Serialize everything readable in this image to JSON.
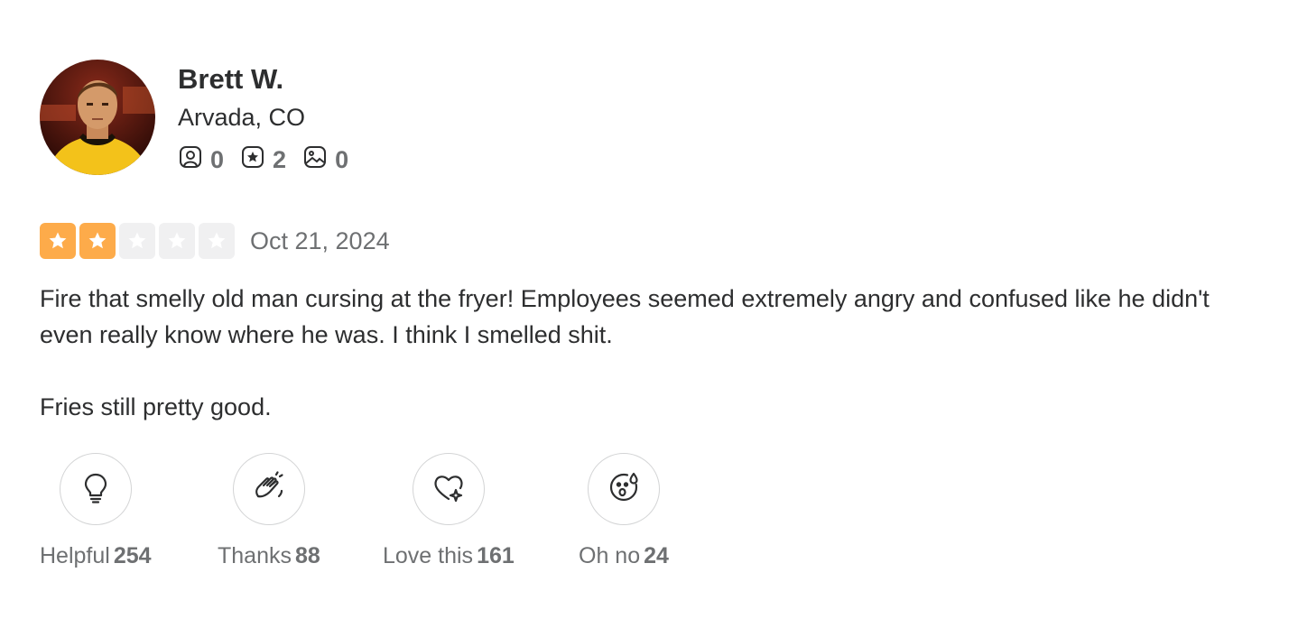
{
  "user": {
    "name": "Brett W.",
    "location": "Arvada, CO",
    "stats": {
      "friends": "0",
      "reviews": "2",
      "photos": "0"
    }
  },
  "review": {
    "rating": 2,
    "max_rating": 5,
    "date": "Oct 21, 2024",
    "paragraphs": [
      "Fire that smelly old man cursing at the fryer! Employees seemed extremely angry and confused like he didn't even really know where he was. I think I smelled shit.",
      "Fries still pretty good."
    ]
  },
  "reactions": [
    {
      "icon": "lightbulb-icon",
      "label": "Helpful",
      "count": "254"
    },
    {
      "icon": "clapping-hands-icon",
      "label": "Thanks",
      "count": "88"
    },
    {
      "icon": "heart-sparkle-icon",
      "label": "Love this",
      "count": "161"
    },
    {
      "icon": "surprised-face-icon",
      "label": "Oh no",
      "count": "24"
    }
  ],
  "colors": {
    "star_on": "#fdab4a",
    "star_off": "#f0f0f1",
    "text": "#2d2e2f",
    "muted": "#6e7072"
  }
}
